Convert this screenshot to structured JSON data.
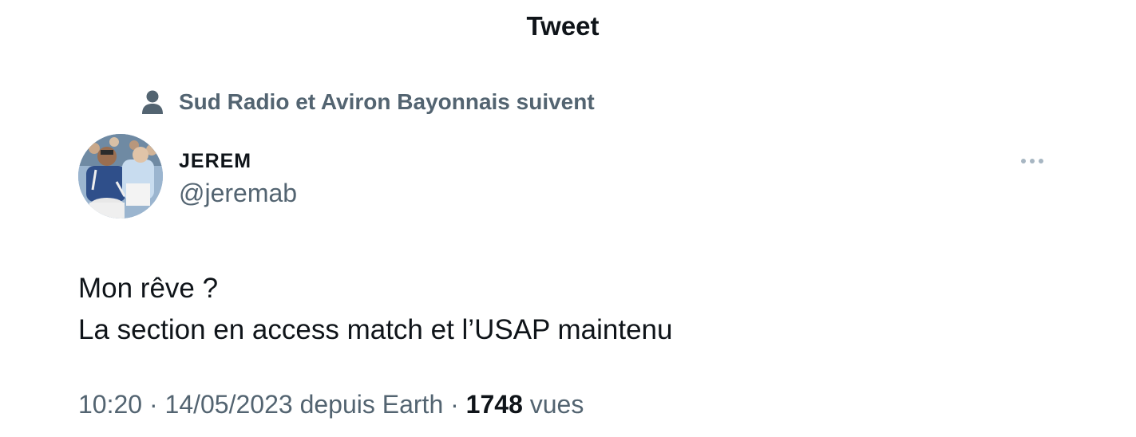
{
  "header": {
    "title": "Tweet"
  },
  "social_context": {
    "text": "Sud Radio et Aviron Bayonnais suivent",
    "icon": "person-icon"
  },
  "author": {
    "display_name": "JEREM",
    "handle": "@jeremab",
    "avatar": "avatar-photo"
  },
  "more_button": {
    "icon": "more-horizontal-icon"
  },
  "tweet": {
    "lines": [
      "Mon rêve ?",
      "La section en access match et l’USAP maintenu"
    ]
  },
  "meta": {
    "time_date": "10:20 · 14/05/2023",
    "source": " depuis Earth · ",
    "views_count": "1748",
    "views_label": " vues"
  },
  "colors": {
    "text_primary": "#0f1419",
    "text_secondary": "#536471",
    "more_dots": "#a7b6c2"
  }
}
